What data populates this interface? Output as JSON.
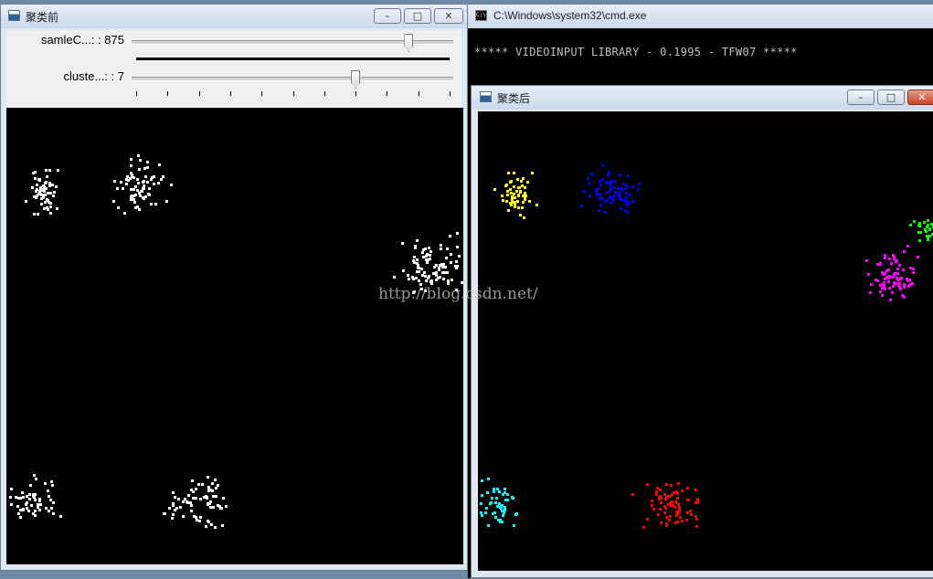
{
  "desktop": {
    "background": "#6c8aa8"
  },
  "window_before": {
    "title": "聚类前",
    "controls": {
      "minimize": "–",
      "maximize": "□",
      "close": "✕"
    },
    "trackbars": [
      {
        "label": "samleC...: : 875",
        "value": 875,
        "position_fraction": 0.87
      },
      {
        "label": "cluste...: : 7",
        "value": 7,
        "position_fraction": 0.7
      }
    ],
    "point_color": "#ffffff"
  },
  "window_cmd": {
    "title": "C:\\Windows\\system32\\cmd.exe",
    "icon_text": "C:\\",
    "output": "***** VIDEOINPUT LIBRARY - 0.1995 - TFW07 *****"
  },
  "window_after": {
    "title": "聚类后",
    "controls": {
      "minimize": "–",
      "maximize": "□",
      "close": "✕"
    },
    "cluster_colors": [
      "#ffff00",
      "#0000ff",
      "#00ff00",
      "#ff00ff",
      "#00ffff",
      "#ff0000",
      "#ffffff"
    ]
  },
  "watermark": "http://blog.csdn.net/"
}
